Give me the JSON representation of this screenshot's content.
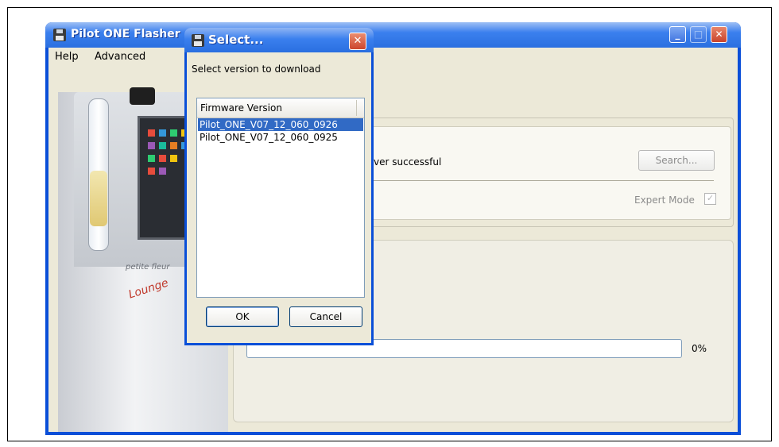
{
  "main_window": {
    "title": "Pilot ONE Flasher",
    "menu": [
      "Help",
      "Advanced"
    ],
    "status_text": "ver successful",
    "search_label": "Search...",
    "expert_mode_label": "Expert Mode",
    "expert_mode_checked": true,
    "check_glyph": "✓",
    "progress_percent": 0,
    "progress_label": "0%",
    "image": {
      "brand": "petite fleur",
      "signature": "Lounge"
    }
  },
  "dialog": {
    "title": "Select...",
    "close_glyph": "✕",
    "prompt": "Select version to download",
    "column_header": "Firmware Version",
    "items": [
      {
        "label": "Pilot_ONE_V07_12_060_0926",
        "selected": true
      },
      {
        "label": "Pilot_ONE_V07_12_060_0925",
        "selected": false
      }
    ],
    "ok_label": "OK",
    "cancel_label": "Cancel"
  },
  "window_controls": {
    "minimize": "_",
    "maximize": "□",
    "close": "✕"
  },
  "colors": {
    "titlebar": "#2a6fe0",
    "selection": "#316ac5",
    "progress": "#3c9c3c"
  }
}
